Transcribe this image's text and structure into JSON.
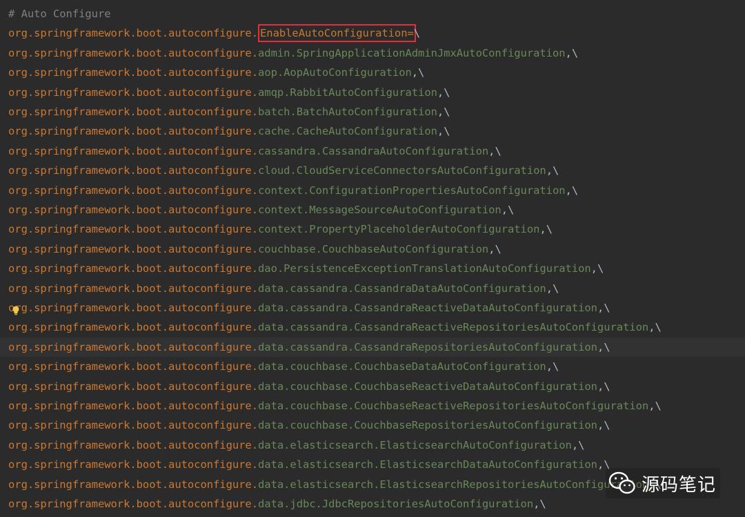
{
  "editor": {
    "comment": "# Auto Configure",
    "key_prefix": "org.springframework.boot.autoconfigure.",
    "key_name": "EnableAutoConfiguration",
    "key_equals": "=",
    "key_continuation": "\\",
    "lines": [
      "org.springframework.boot.autoconfigure.admin.SpringApplicationAdminJmxAutoConfiguration,\\",
      "org.springframework.boot.autoconfigure.aop.AopAutoConfiguration,\\",
      "org.springframework.boot.autoconfigure.amqp.RabbitAutoConfiguration,\\",
      "org.springframework.boot.autoconfigure.batch.BatchAutoConfiguration,\\",
      "org.springframework.boot.autoconfigure.cache.CacheAutoConfiguration,\\",
      "org.springframework.boot.autoconfigure.cassandra.CassandraAutoConfiguration,\\",
      "org.springframework.boot.autoconfigure.cloud.CloudServiceConnectorsAutoConfiguration,\\",
      "org.springframework.boot.autoconfigure.context.ConfigurationPropertiesAutoConfiguration,\\",
      "org.springframework.boot.autoconfigure.context.MessageSourceAutoConfiguration,\\",
      "org.springframework.boot.autoconfigure.context.PropertyPlaceholderAutoConfiguration,\\",
      "org.springframework.boot.autoconfigure.couchbase.CouchbaseAutoConfiguration,\\",
      "org.springframework.boot.autoconfigure.dao.PersistenceExceptionTranslationAutoConfiguration,\\",
      "org.springframework.boot.autoconfigure.data.cassandra.CassandraDataAutoConfiguration,\\",
      "org.springframework.boot.autoconfigure.data.cassandra.CassandraReactiveDataAutoConfiguration,\\",
      "org.springframework.boot.autoconfigure.data.cassandra.CassandraReactiveRepositoriesAutoConfiguration,\\",
      "org.springframework.boot.autoconfigure.data.cassandra.CassandraRepositoriesAutoConfiguration,\\",
      "org.springframework.boot.autoconfigure.data.couchbase.CouchbaseDataAutoConfiguration,\\",
      "org.springframework.boot.autoconfigure.data.couchbase.CouchbaseReactiveDataAutoConfiguration,\\",
      "org.springframework.boot.autoconfigure.data.couchbase.CouchbaseReactiveRepositoriesAutoConfiguration,\\",
      "org.springframework.boot.autoconfigure.data.couchbase.CouchbaseRepositoriesAutoConfiguration,\\",
      "org.springframework.boot.autoconfigure.data.elasticsearch.ElasticsearchAutoConfiguration,\\",
      "org.springframework.boot.autoconfigure.data.elasticsearch.ElasticsearchDataAutoConfiguration,\\",
      "org.springframework.boot.autoconfigure.data.elasticsearch.ElasticsearchRepositoriesAutoConfiguration,\\",
      "org.springframework.boot.autoconfigure.data.jdbc.JdbcRepositoriesAutoConfiguration,\\"
    ],
    "caret_line_index": 15,
    "intention_icon": "lightbulb-icon",
    "colors": {
      "background": "#2b2b2b",
      "caret_line": "#323232",
      "comment": "#808080",
      "key": "#cc7832",
      "value": "#6a8759",
      "highlight_box": "#e0303a"
    }
  },
  "watermark": {
    "icon": "wechat-icon",
    "text": "源码笔记"
  }
}
